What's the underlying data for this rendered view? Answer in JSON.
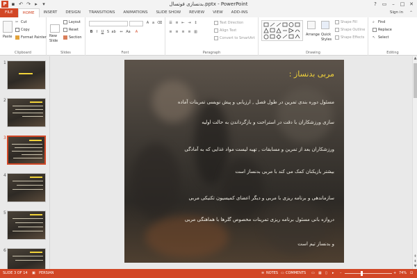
{
  "app": {
    "title": "بدنسازی فوتسال.pptx - PowerPoint",
    "logo_letter": "P"
  },
  "tabs": [
    "FILE",
    "HOME",
    "INSERT",
    "DESIGN",
    "TRANSITIONS",
    "ANIMATIONS",
    "SLIDE SHOW",
    "REVIEW",
    "VIEW",
    "ADD-INS"
  ],
  "active_tab": "HOME",
  "sign_in": "Sign in",
  "ribbon": {
    "clipboard": {
      "paste": "Paste",
      "cut": "Cut",
      "copy": "Copy",
      "format_painter": "Format Painter",
      "label": "Clipboard"
    },
    "slides": {
      "new_slide": "New",
      "new_slide2": "Slide",
      "layout": "Layout",
      "reset": "Reset",
      "section": "Section",
      "label": "Slides"
    },
    "font": {
      "label": "Font"
    },
    "paragraph": {
      "text_direction": "Text Direction",
      "align_text": "Align Text",
      "convert_smartart": "Convert to SmartArt",
      "label": "Paragraph"
    },
    "drawing": {
      "arrange": "Arrange",
      "quick_styles": "Quick",
      "quick_styles2": "Styles",
      "shape_fill": "Shape Fill",
      "shape_outline": "Shape Outline",
      "shape_effects": "Shape Effects",
      "label": "Drawing"
    },
    "editing": {
      "find": "Find",
      "replace": "Replace",
      "select": "Select",
      "label": "Editing"
    }
  },
  "thumbnails": [
    {
      "number": "1",
      "selected": false
    },
    {
      "number": "2",
      "selected": false
    },
    {
      "number": "3",
      "selected": true
    },
    {
      "number": "4",
      "selected": false
    },
    {
      "number": "5",
      "selected": false
    },
    {
      "number": "6",
      "selected": false
    }
  ],
  "slide": {
    "title": "مربی بدنساز :",
    "lines": [
      "مسئول دوره بندی تمرین در طول فصل , ارزیابی و پیش نویسی تمرینات آماده",
      "سازی ورزشکاران با دقت در استراحت و بازگرداندن به حالت اولیه",
      "ورزشکاران بعد از تمرین و مسابقات , تهیه لیست مواد غذایی که به آمادگی",
      "بیشتر بازیکنان کمک می کند با مربی بدنساز است",
      "سازماندهی و برنامه ریزی با مربی و دیگر اعضای کمیسیون تکنیکی مربی",
      "دروازه بانی مسئول برنامه ریزی تمرینات مخصوص گلرها با هماهنگی مربی",
      "و بدنساز تیم است"
    ]
  },
  "status": {
    "slide_indicator": "SLIDE 3 OF 14",
    "language": "PERSIAN",
    "notes": "NOTES",
    "comments": "COMMENTS",
    "zoom": "74%",
    "zoom_fraction": 0.74
  },
  "colors": {
    "accent": "#d24726",
    "title_yellow": "#f1d33a"
  }
}
